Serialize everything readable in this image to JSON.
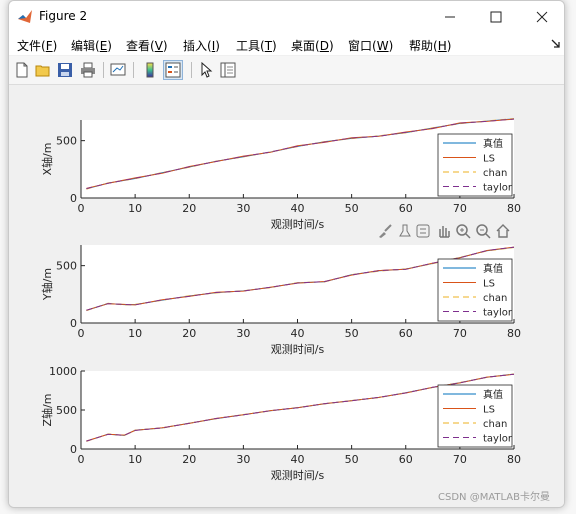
{
  "window": {
    "title": "Figure 2",
    "minimize_icon": "minimize-icon",
    "maximize_icon": "maximize-icon",
    "close_icon": "close-icon"
  },
  "menu": {
    "items": [
      {
        "label": "文件(",
        "key": "F",
        "tail": ")"
      },
      {
        "label": "编辑(",
        "key": "E",
        "tail": ")"
      },
      {
        "label": "查看(",
        "key": "V",
        "tail": ")"
      },
      {
        "label": "插入(",
        "key": "I",
        "tail": ")"
      },
      {
        "label": "工具(",
        "key": "T",
        "tail": ")"
      },
      {
        "label": "桌面(",
        "key": "D",
        "tail": ")"
      },
      {
        "label": "窗口(",
        "key": "W",
        "tail": ")"
      },
      {
        "label": "帮助(",
        "key": "H",
        "tail": ")"
      }
    ]
  },
  "toolbar": {
    "icons": [
      "new-figure-icon",
      "open-file-icon",
      "save-icon",
      "print-icon",
      "link-plot-icon",
      "colorbar-icon",
      "legend-icon",
      "edit-pointer-icon",
      "property-inspector-icon"
    ]
  },
  "axes_toolbar": {
    "icons": [
      "brush-icon",
      "data-tips-icon",
      "export-icon",
      "pan-icon",
      "zoom-in-icon",
      "zoom-out-icon",
      "home-icon"
    ]
  },
  "watermark": "CSDN @MATLAB卡尔曼",
  "colors": {
    "truth": "#0072BD",
    "ls": "#D95319",
    "chan": "#EDB120",
    "taylor": "#7E2F8E"
  },
  "chart_data": [
    {
      "type": "line",
      "xlabel": "观测时间/s",
      "ylabel": "X轴/m",
      "xlim": [
        0,
        80
      ],
      "ylim": [
        0,
        680
      ],
      "xticks": [
        0,
        10,
        20,
        30,
        40,
        50,
        60,
        70,
        80
      ],
      "yticks": [
        0,
        500
      ],
      "legend": [
        "真值",
        "LS",
        "chan",
        "taylor"
      ],
      "legend_position": "bottom-right",
      "x": [
        1,
        5,
        10,
        15,
        20,
        25,
        30,
        35,
        40,
        45,
        50,
        55,
        60,
        65,
        70,
        75,
        80
      ],
      "series": [
        {
          "name": "真值",
          "values": [
            80,
            130,
            170,
            220,
            270,
            320,
            360,
            400,
            450,
            490,
            520,
            540,
            570,
            610,
            650,
            670,
            690
          ]
        },
        {
          "name": "LS",
          "values": [
            85,
            128,
            175,
            215,
            275,
            318,
            365,
            398,
            455,
            485,
            525,
            538,
            575,
            605,
            655,
            668,
            688
          ]
        },
        {
          "name": "chan",
          "values": [
            78,
            132,
            168,
            222,
            268,
            322,
            358,
            402,
            448,
            492,
            518,
            542,
            568,
            612,
            648,
            672,
            692
          ]
        },
        {
          "name": "taylor",
          "values": [
            82,
            129,
            172,
            218,
            272,
            319,
            362,
            401,
            452,
            488,
            522,
            539,
            572,
            608,
            652,
            669,
            689
          ]
        }
      ]
    },
    {
      "type": "line",
      "xlabel": "观测时间/s",
      "ylabel": "Y轴/m",
      "xlim": [
        0,
        80
      ],
      "ylim": [
        0,
        680
      ],
      "xticks": [
        0,
        10,
        20,
        30,
        40,
        50,
        60,
        70,
        80
      ],
      "yticks": [
        0,
        500
      ],
      "legend": [
        "真值",
        "LS",
        "chan",
        "taylor"
      ],
      "legend_position": "bottom-right",
      "x": [
        1,
        5,
        8,
        10,
        15,
        20,
        25,
        30,
        35,
        40,
        45,
        50,
        55,
        60,
        65,
        70,
        75,
        80
      ],
      "series": [
        {
          "name": "真值",
          "values": [
            110,
            170,
            160,
            160,
            200,
            235,
            265,
            280,
            310,
            350,
            360,
            420,
            455,
            470,
            520,
            570,
            630,
            660
          ]
        },
        {
          "name": "LS",
          "values": [
            112,
            168,
            162,
            158,
            202,
            232,
            268,
            278,
            312,
            348,
            362,
            418,
            458,
            468,
            522,
            568,
            632,
            662
          ]
        },
        {
          "name": "chan",
          "values": [
            108,
            172,
            158,
            162,
            198,
            238,
            262,
            282,
            308,
            352,
            358,
            422,
            452,
            472,
            518,
            572,
            628,
            658
          ]
        },
        {
          "name": "taylor",
          "values": [
            111,
            169,
            161,
            159,
            201,
            234,
            266,
            279,
            311,
            349,
            361,
            419,
            456,
            469,
            521,
            569,
            631,
            661
          ]
        }
      ]
    },
    {
      "type": "line",
      "xlabel": "观测时间/s",
      "ylabel": "Z轴/m",
      "xlim": [
        0,
        80
      ],
      "ylim": [
        0,
        1000
      ],
      "xticks": [
        0,
        10,
        20,
        30,
        40,
        50,
        60,
        70,
        80
      ],
      "yticks": [
        0,
        500,
        1000
      ],
      "legend": [
        "真值",
        "LS",
        "chan",
        "taylor"
      ],
      "legend_position": "bottom-right",
      "x": [
        1,
        5,
        8,
        10,
        15,
        20,
        25,
        30,
        35,
        40,
        45,
        50,
        55,
        60,
        65,
        70,
        75,
        80
      ],
      "series": [
        {
          "name": "真值",
          "values": [
            100,
            190,
            175,
            240,
            270,
            330,
            390,
            440,
            490,
            530,
            580,
            620,
            660,
            720,
            790,
            850,
            920,
            960
          ]
        },
        {
          "name": "LS",
          "values": [
            102,
            188,
            178,
            238,
            272,
            328,
            392,
            438,
            492,
            528,
            582,
            618,
            662,
            718,
            792,
            848,
            922,
            958
          ]
        },
        {
          "name": "chan",
          "values": [
            98,
            192,
            172,
            242,
            268,
            332,
            388,
            442,
            488,
            532,
            578,
            622,
            658,
            722,
            788,
            852,
            918,
            962
          ]
        },
        {
          "name": "taylor",
          "values": [
            101,
            189,
            176,
            239,
            271,
            329,
            391,
            439,
            491,
            529,
            581,
            619,
            661,
            719,
            791,
            849,
            921,
            959
          ]
        }
      ]
    }
  ]
}
